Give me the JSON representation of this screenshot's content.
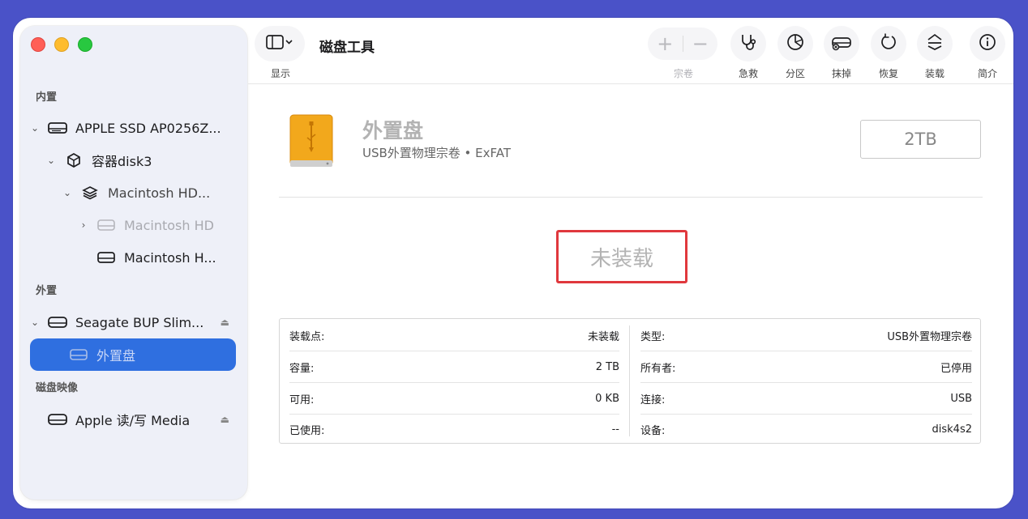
{
  "toolbar": {
    "sidebar_toggle_label": "显示",
    "app_title": "磁盘工具",
    "volume_label": "宗卷",
    "buttons": [
      {
        "label": "急救",
        "icon": "stethoscope-icon"
      },
      {
        "label": "分区",
        "icon": "pie-chart-icon"
      },
      {
        "label": "抹掉",
        "icon": "erase-drive-icon"
      },
      {
        "label": "恢复",
        "icon": "restore-icon"
      },
      {
        "label": "装载",
        "icon": "mount-icon"
      },
      {
        "label": "简介",
        "icon": "info-icon"
      }
    ]
  },
  "sidebar": {
    "sections": {
      "internal": "内置",
      "external": "外置",
      "images": "磁盘映像"
    },
    "items": [
      {
        "label": "APPLE SSD AP0256Z...",
        "icon": "internal-drive-icon"
      },
      {
        "label": "容器disk3",
        "icon": "container-icon"
      },
      {
        "label": "Macintosh HD...",
        "icon": "volume-group-icon"
      },
      {
        "label": "Macintosh HD",
        "icon": "drive-icon"
      },
      {
        "label": "Macintosh H...",
        "icon": "drive-icon"
      },
      {
        "label": "Seagate BUP Slim...",
        "icon": "external-drive-icon"
      },
      {
        "label": "外置盘",
        "icon": "drive-icon"
      },
      {
        "label": "Apple 读/写 Media",
        "icon": "external-drive-icon"
      }
    ]
  },
  "disk": {
    "name": "外置盘",
    "subtitle": "USB外置物理宗卷 • ExFAT",
    "size": "2TB",
    "status": "未装载"
  },
  "info": {
    "left": [
      {
        "key": "装载点:",
        "value": "未装载"
      },
      {
        "key": "容量:",
        "value": "2 TB"
      },
      {
        "key": "可用:",
        "value": "0 KB"
      },
      {
        "key": "已使用:",
        "value": "--"
      }
    ],
    "right": [
      {
        "key": "类型:",
        "value": "USB外置物理宗卷"
      },
      {
        "key": "所有者:",
        "value": "已停用"
      },
      {
        "key": "连接:",
        "value": "USB"
      },
      {
        "key": "设备:",
        "value": "disk4s2"
      }
    ]
  },
  "colors": {
    "accent": "#2f6fe0",
    "highlight_border": "#e0383d",
    "disk_icon": "#f2a81c"
  }
}
